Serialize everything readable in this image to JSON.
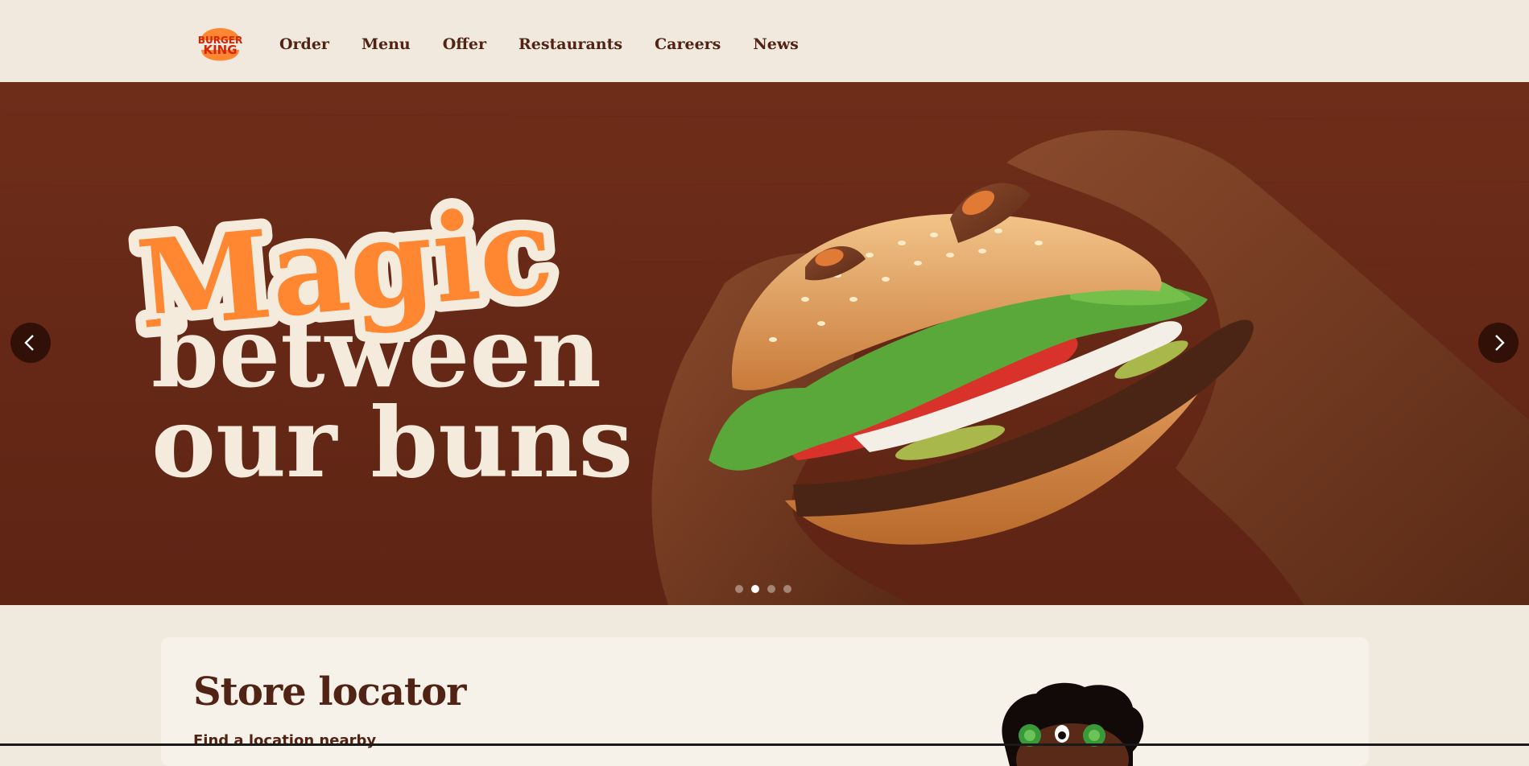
{
  "header": {
    "logo_text_top": "BURGER",
    "logo_text_bottom": "KING",
    "nav": [
      {
        "label": "Order"
      },
      {
        "label": "Menu"
      },
      {
        "label": "Offer"
      },
      {
        "label": "Restaurants"
      },
      {
        "label": "Careers"
      },
      {
        "label": "News"
      }
    ]
  },
  "hero": {
    "headline_word1": "Magic",
    "headline_word2": "between",
    "headline_word3": "our buns",
    "slides_total": 4,
    "active_slide": 2,
    "prev_icon": "chevron-left-icon",
    "next_icon": "chevron-right-icon"
  },
  "locator": {
    "title": "Store locator",
    "subtitle": "Find a location nearby"
  },
  "colors": {
    "brand_brown": "#502314",
    "brand_orange": "#ff8732",
    "brand_red": "#d62300",
    "cream": "#f5ebdc"
  }
}
